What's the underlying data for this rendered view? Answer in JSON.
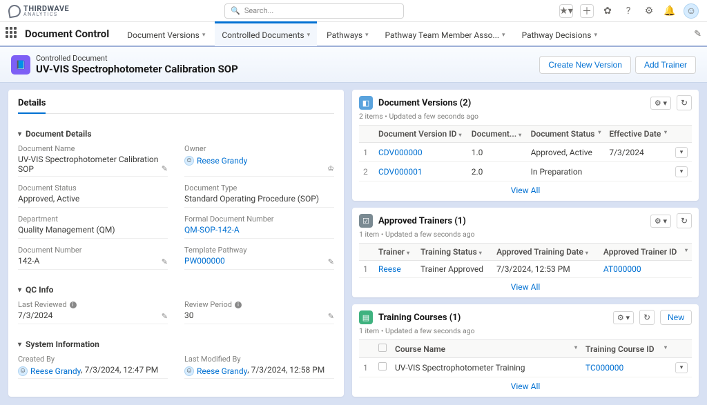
{
  "top": {
    "logo_main": "THIRDWAVE",
    "logo_sub": "ANALYTICS",
    "search_placeholder": "Search..."
  },
  "nav": {
    "app_name": "Document Control",
    "items": [
      "Document Versions",
      "Controlled Documents",
      "Pathways",
      "Pathway Team Member Asso...",
      "Pathway Decisions"
    ],
    "active_index": 1
  },
  "header": {
    "crumb": "Controlled Document",
    "title": "UV-VIS Spectrophotometer Calibration SOP",
    "btn_create": "Create New Version",
    "btn_add_trainer": "Add Trainer"
  },
  "details": {
    "tab": "Details",
    "section_document": "Document Details",
    "fields": {
      "doc_name_lbl": "Document Name",
      "doc_name_val": "UV-VIS Spectrophotometer Calibration SOP",
      "owner_lbl": "Owner",
      "owner_val": "Reese Grandy",
      "status_lbl": "Document Status",
      "status_val": "Approved, Active",
      "doctype_lbl": "Document Type",
      "doctype_val": "Standard Operating Procedure (SOP)",
      "dept_lbl": "Department",
      "dept_val": "Quality Management (QM)",
      "formal_lbl": "Formal Document Number",
      "formal_val": "QM-SOP-142-A",
      "docnum_lbl": "Document Number",
      "docnum_val": "142-A",
      "template_lbl": "Template Pathway",
      "template_val": "PW000000"
    },
    "section_qc": "QC Info",
    "qc": {
      "last_reviewed_lbl": "Last Reviewed",
      "last_reviewed_val": "7/3/2024",
      "review_period_lbl": "Review Period",
      "review_period_val": "30"
    },
    "section_sys": "System Information",
    "sys": {
      "created_by_lbl": "Created By",
      "created_by_name": "Reese Grandy",
      "created_by_time": ", 7/3/2024, 12:47 PM",
      "modified_by_lbl": "Last Modified By",
      "modified_by_name": "Reese Grandy",
      "modified_by_time": ", 7/3/2024, 12:58 PM"
    }
  },
  "versions": {
    "title": "Document Versions (2)",
    "meta": "2 items • Updated a few seconds ago",
    "cols": [
      "Document Version ID",
      "Document...",
      "Document Status",
      "Effective Date"
    ],
    "rows": [
      {
        "id": "CDV000000",
        "ver": "1.0",
        "status": "Approved, Active",
        "date": "7/3/2024"
      },
      {
        "id": "CDV000001",
        "ver": "2.0",
        "status": "In Preparation",
        "date": ""
      }
    ],
    "view_all": "View All"
  },
  "trainers": {
    "title": "Approved Trainers (1)",
    "meta": "1 item • Updated a few seconds ago",
    "cols": [
      "Trainer",
      "Training Status",
      "Approved Training Date",
      "Approved Trainer ID"
    ],
    "rows": [
      {
        "trainer": "Reese",
        "status": "Trainer Approved",
        "date": "7/3/2024, 12:53 PM",
        "id": "AT000000"
      }
    ],
    "view_all": "View All"
  },
  "courses": {
    "title": "Training Courses (1)",
    "meta": "1 item • Updated a few seconds ago",
    "new_btn": "New",
    "cols": [
      "Course Name",
      "Training Course ID"
    ],
    "rows": [
      {
        "name": "UV-VIS Spectrophotometer Training",
        "id": "TC000000"
      }
    ],
    "view_all": "View All"
  }
}
